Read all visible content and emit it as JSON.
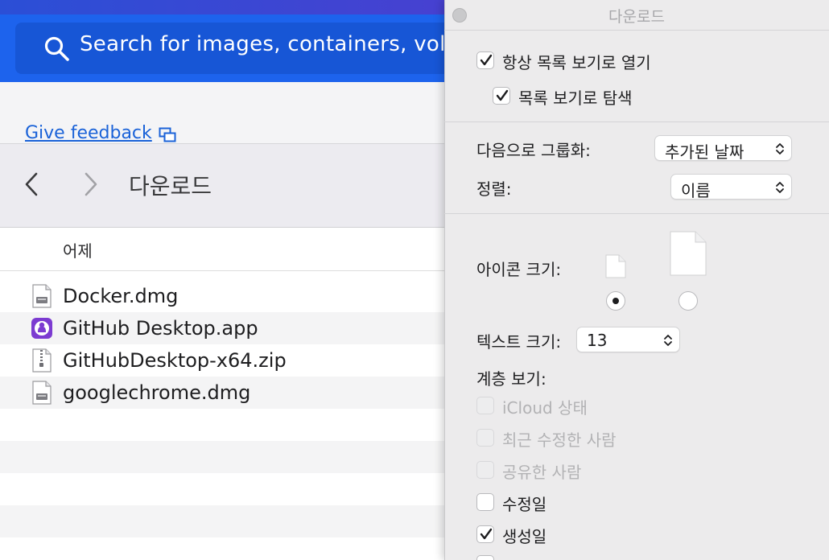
{
  "docker": {
    "search_placeholder": "Search for images, containers, volu",
    "feedback_label": "Give feedback"
  },
  "finder": {
    "title": "다운로드",
    "group_header": "어제",
    "files": [
      {
        "name": "Docker.dmg",
        "icon": "disk-image-icon"
      },
      {
        "name": "GitHub Desktop.app",
        "icon": "github-app-icon"
      },
      {
        "name": "GitHubDesktop-x64.zip",
        "icon": "zip-archive-icon"
      },
      {
        "name": "googlechrome.dmg",
        "icon": "disk-image-icon"
      }
    ]
  },
  "view_options": {
    "title": "다운로드",
    "always_open_list_view": {
      "label": "항상 목록 보기로 열기",
      "checked": true
    },
    "browse_list_view": {
      "label": "목록 보기로 탐색",
      "checked": true
    },
    "group_by": {
      "label": "다음으로 그룹화:",
      "value": "추가된 날짜"
    },
    "sort_by": {
      "label": "정렬:",
      "value": "이름"
    },
    "icon_size": {
      "label": "아이콘 크기:",
      "selected": "small"
    },
    "text_size": {
      "label": "텍스트 크기:",
      "value": "13"
    },
    "show_columns_label": "계층 보기:",
    "columns": [
      {
        "label": "iCloud 상태",
        "checked": false,
        "enabled": false
      },
      {
        "label": "최근 수정한 사람",
        "checked": false,
        "enabled": false
      },
      {
        "label": "공유한 사람",
        "checked": false,
        "enabled": false
      },
      {
        "label": "수정일",
        "checked": false,
        "enabled": true
      },
      {
        "label": "생성일",
        "checked": true,
        "enabled": true
      }
    ]
  },
  "colors": {
    "docker_blue": "#1d63ed",
    "link_blue": "#1a62d8",
    "panel_bg": "#ecebec"
  }
}
